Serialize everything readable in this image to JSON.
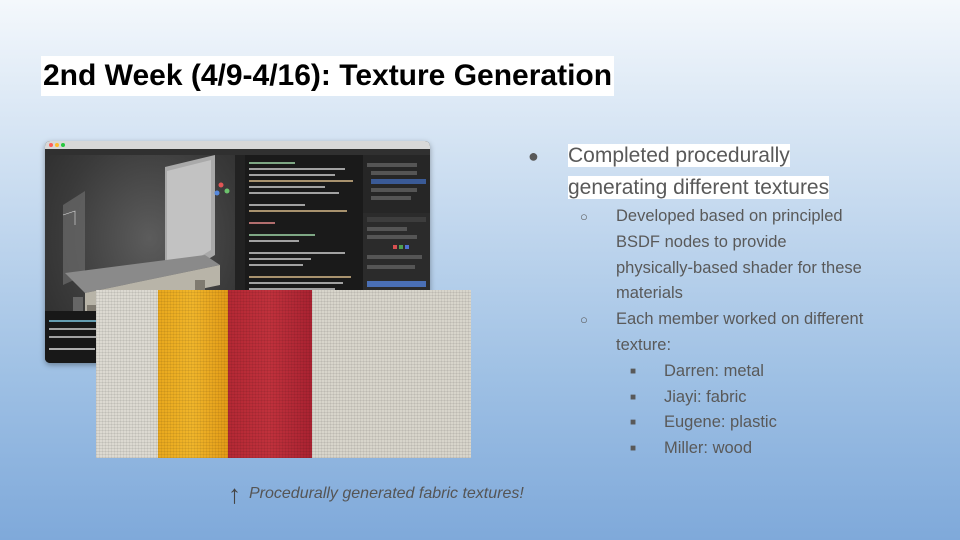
{
  "slide": {
    "title": "2nd Week (4/9-4/16): Texture Generation",
    "bullet_main": {
      "marker": "●",
      "line1": "Completed procedurally",
      "line2": "generating different textures"
    },
    "sub_bullets": [
      {
        "marker": "○",
        "lines": [
          "Developed based on principled",
          "BSDF nodes to provide",
          "physically-based shader for these",
          "materials"
        ]
      },
      {
        "marker": "○",
        "lines": [
          "Each member worked on different",
          "texture:"
        ]
      }
    ],
    "members": [
      {
        "marker": "■",
        "text": "Darren: metal"
      },
      {
        "marker": "■",
        "text": "Jiayi: fabric"
      },
      {
        "marker": "■",
        "text": "Eugene: plastic"
      },
      {
        "marker": "■",
        "text": "Miller: wood"
      }
    ],
    "caption": {
      "arrow": "↑",
      "text": "Procedurally generated fabric textures!"
    }
  },
  "images": {
    "blender_screenshot": {
      "icon": "blender-editor-screenshot"
    },
    "fabric_swatches": {
      "icon": "fabric-texture-swatches",
      "colors": [
        "#dcd9d1",
        "#e9a81d",
        "#b42834",
        "#d8d5cb"
      ]
    }
  }
}
